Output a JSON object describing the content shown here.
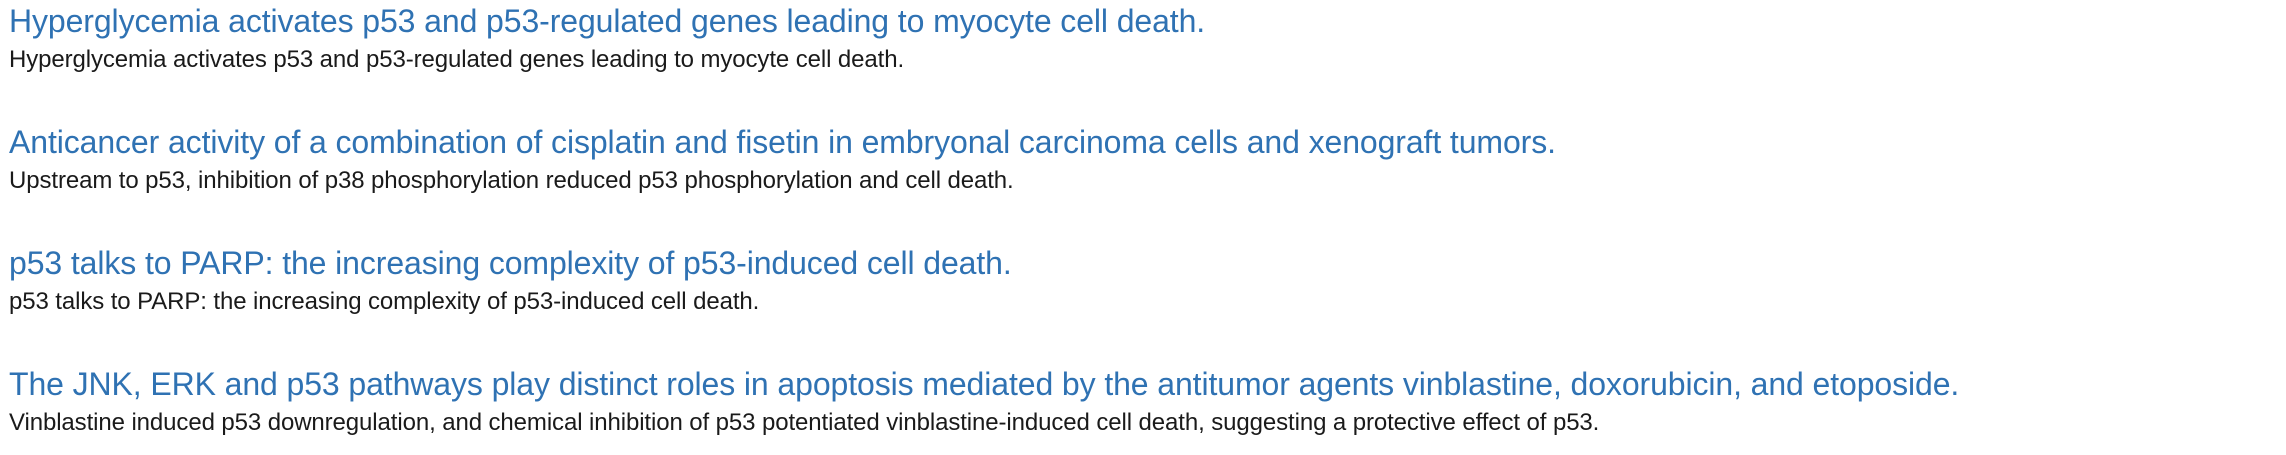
{
  "results": [
    {
      "title": "Hyperglycemia activates p53 and p53-regulated genes leading to myocyte cell death.",
      "snippet": "Hyperglycemia activates p53 and p53-regulated genes leading to myocyte cell death."
    },
    {
      "title": "Anticancer activity of a combination of cisplatin and fisetin in embryonal carcinoma cells and xenograft tumors.",
      "snippet": "Upstream to p53, inhibition of p38 phosphorylation reduced p53 phosphorylation and cell death."
    },
    {
      "title": "p53 talks to PARP: the increasing complexity of p53-induced cell death.",
      "snippet": "p53 talks to PARP: the increasing complexity of p53-induced cell death."
    },
    {
      "title": "The JNK, ERK and p53 pathways play distinct roles in apoptosis mediated by the antitumor agents vinblastine, doxorubicin, and etoposide.",
      "snippet": "Vinblastine induced p53 downregulation, and chemical inhibition of p53 potentiated vinblastine-induced cell death, suggesting a protective effect of p53."
    }
  ],
  "colors": {
    "link": "#2f72b3",
    "text": "#1a1a1a"
  }
}
